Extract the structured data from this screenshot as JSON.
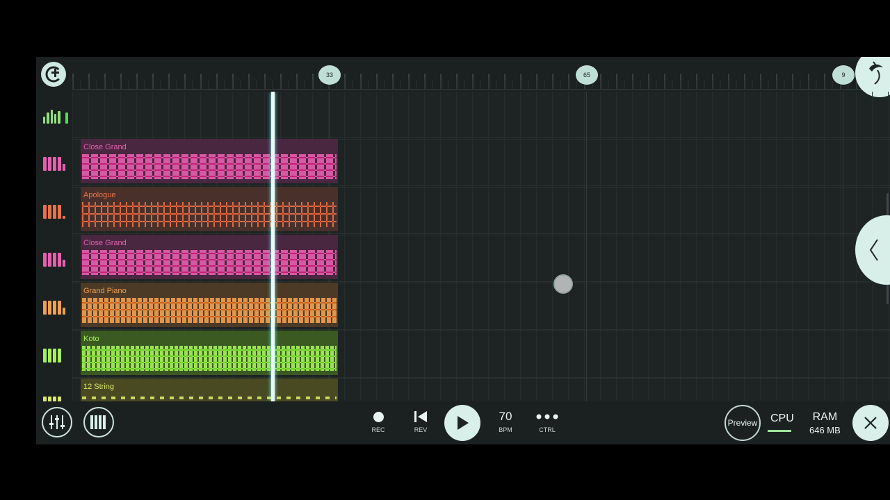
{
  "ruler": {
    "markers": [
      "33",
      "65",
      "9"
    ]
  },
  "tracks": [
    {
      "name": "Close Grand",
      "color": "#e65fb0",
      "bg": "#4a2740",
      "icon": "piano-keys-icon"
    },
    {
      "name": "Apologue",
      "color": "#e8734a",
      "bg": "#4a302a",
      "icon": "piano-keys-icon"
    },
    {
      "name": "Close Grand",
      "color": "#e65fb0",
      "bg": "#4a2740",
      "icon": "piano-keys-icon"
    },
    {
      "name": "Grand Piano",
      "color": "#f0a050",
      "bg": "#4d3a26",
      "icon": "piano-keys-icon"
    },
    {
      "name": "Koto",
      "color": "#a8f05a",
      "bg": "#3a5a22",
      "icon": "piano-keys-icon"
    },
    {
      "name": "12 String",
      "color": "#d8e86a",
      "bg": "#4a4a22",
      "icon": "piano-keys-icon"
    }
  ],
  "transport": {
    "rec_label": "REC",
    "rev_label": "REV",
    "bpm_value": "70",
    "bpm_label": "BPM",
    "ctrl_label": "CTRL"
  },
  "status": {
    "preview_label": "Preview",
    "cpu_label": "CPU",
    "ram_label": "RAM",
    "ram_value": "646 MB"
  },
  "icons": {
    "logo": "app-logo-icon",
    "mixer": "mixer-icon",
    "keyboard": "keyboard-icon",
    "close": "close-icon"
  }
}
